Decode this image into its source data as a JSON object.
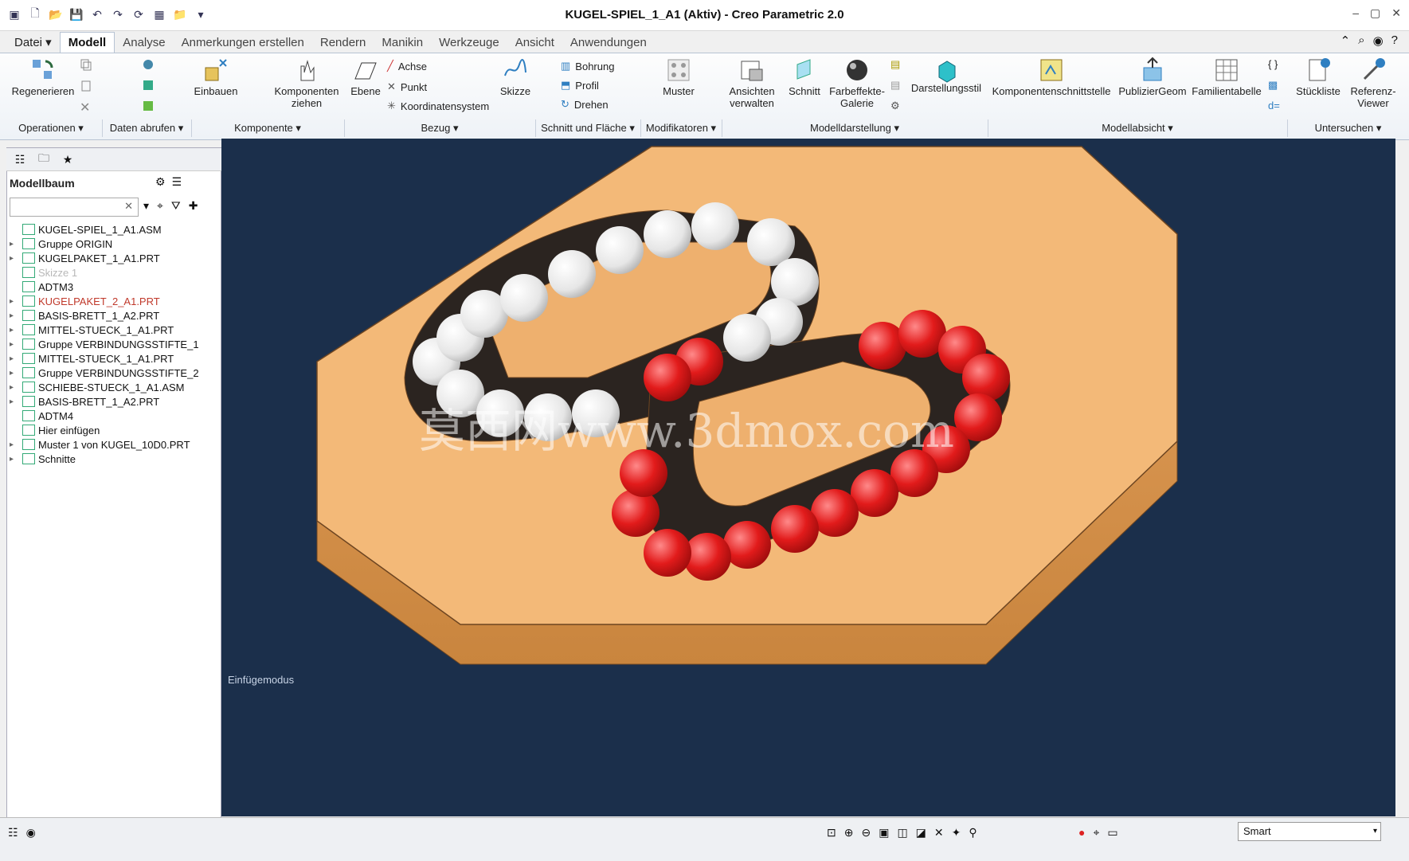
{
  "window": {
    "title": "KUGEL-SPIEL_1_A1 (Aktiv) - Creo Parametric 2.0"
  },
  "menu_tabs": [
    {
      "label": "Datei ▾"
    },
    {
      "label": "Modell"
    },
    {
      "label": "Analyse"
    },
    {
      "label": "Anmerkungen erstellen"
    },
    {
      "label": "Rendern"
    },
    {
      "label": "Manikin"
    },
    {
      "label": "Werkzeuge"
    },
    {
      "label": "Ansicht"
    },
    {
      "label": "Anwendungen"
    }
  ],
  "ribbon": {
    "regenerieren": "Regenerieren",
    "einbauen": "Einbauen",
    "komponenten_ziehen": "Komponenten ziehen",
    "ebene": "Ebene",
    "achse": "Achse",
    "punkt": "Punkt",
    "koordinatensystem": "Koordinatensystem",
    "skizze": "Skizze",
    "bohrung": "Bohrung",
    "profil": "Profil",
    "drehen": "Drehen",
    "muster": "Muster",
    "ansichten_verwalten": "Ansichten verwalten",
    "schnitt": "Schnitt",
    "farbeffekte_galerie": "Farbeffekte-Galerie",
    "darstellungsstil": "Darstellungsstil",
    "komponentenschnittstelle": "Komponentenschnittstelle",
    "publiziergeom": "PublizierGeom",
    "familientabelle": "Familientabelle",
    "stueckliste": "Stückliste",
    "referenz_viewer": "Referenz-Viewer"
  },
  "groups": [
    {
      "label": "Operationen ▾"
    },
    {
      "label": "Daten abrufen ▾"
    },
    {
      "label": "Komponente ▾"
    },
    {
      "label": "Bezug ▾"
    },
    {
      "label": "Schnitt und Fläche ▾"
    },
    {
      "label": "Modifikatoren ▾"
    },
    {
      "label": "Modelldarstellung ▾"
    },
    {
      "label": "Modellabsicht ▾"
    },
    {
      "label": "Untersuchen ▾"
    }
  ],
  "model_tree": {
    "header": "Modellbaum",
    "search_placeholder": "",
    "items": [
      {
        "label": "KUGEL-SPIEL_1_A1.ASM",
        "expand": "",
        "color": "#111111"
      },
      {
        "label": "Gruppe ORIGIN",
        "expand": "▸",
        "color": "#111111"
      },
      {
        "label": "KUGELPAKET_1_A1.PRT",
        "expand": "▸",
        "color": "#111111"
      },
      {
        "label": "Skizze 1",
        "expand": "",
        "color": "#b8b8b8"
      },
      {
        "label": "ADTM3",
        "expand": "",
        "color": "#111111"
      },
      {
        "label": "KUGELPAKET_2_A1.PRT",
        "expand": "▸",
        "color": "#c0392b"
      },
      {
        "label": "BASIS-BRETT_1_A2.PRT",
        "expand": "▸",
        "color": "#111111"
      },
      {
        "label": "MITTEL-STUECK_1_A1.PRT",
        "expand": "▸",
        "color": "#111111"
      },
      {
        "label": "Gruppe VERBINDUNGSSTIFTE_1",
        "expand": "▸",
        "color": "#111111"
      },
      {
        "label": "MITTEL-STUECK_1_A1.PRT",
        "expand": "▸",
        "color": "#111111"
      },
      {
        "label": "Gruppe VERBINDUNGSSTIFTE_2",
        "expand": "▸",
        "color": "#111111"
      },
      {
        "label": "SCHIEBE-STUECK_1_A1.ASM",
        "expand": "▸",
        "color": "#111111"
      },
      {
        "label": "BASIS-BRETT_1_A2.PRT",
        "expand": "▸",
        "color": "#111111"
      },
      {
        "label": "ADTM4",
        "expand": "",
        "color": "#111111"
      },
      {
        "label": "Hier einfügen",
        "expand": "",
        "color": "#111111"
      },
      {
        "label": "Muster 1 von KUGEL_10D0.PRT",
        "expand": "▸",
        "color": "#111111"
      },
      {
        "label": "Schnitte",
        "expand": "▸",
        "color": "#111111"
      }
    ]
  },
  "viewport": {
    "mode_text": "Einfügemodus",
    "watermark": "莫西网www.3dmox.com"
  },
  "status_bar": {
    "filter_value": "Smart"
  },
  "colors": {
    "viewport_bg": "#1b2f4b",
    "wood": "#f3b978",
    "white_ball": "#f2f2f2",
    "red_ball": "#e21b1b"
  }
}
